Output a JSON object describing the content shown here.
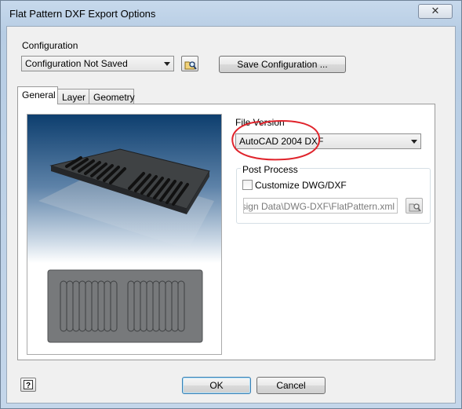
{
  "window": {
    "title": "Flat Pattern DXF Export Options",
    "close_glyph": "✕"
  },
  "configuration": {
    "label": "Configuration",
    "selected": "Configuration Not Saved",
    "save_button": "Save Configuration ..."
  },
  "tabs": [
    {
      "label": "General",
      "active": true
    },
    {
      "label": "Layer",
      "active": false
    },
    {
      "label": "Geometry",
      "active": false
    }
  ],
  "file_version": {
    "label": "File Version",
    "selected": "AutoCAD 2004 DXF"
  },
  "post_process": {
    "label": "Post Process",
    "customize_label": "Customize DWG/DXF",
    "customize_checked": false,
    "path_value": "Design Data\\DWG-DXF\\FlatPattern.xml"
  },
  "footer": {
    "help_glyph": "?",
    "ok_label": "OK",
    "cancel_label": "Cancel"
  },
  "icons": {
    "browse_config": "folder-search-icon",
    "browse_path": "folder-search-icon",
    "help": "help-icon"
  },
  "colors": {
    "annotation": "#e0242c",
    "preview_top": "#0d3e6e",
    "part": "#3a3c3e"
  }
}
